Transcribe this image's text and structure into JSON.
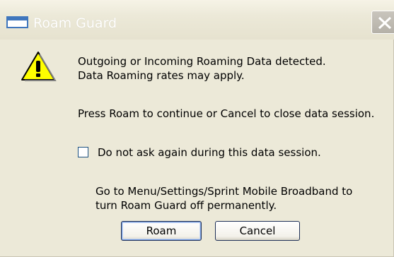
{
  "window": {
    "title": "Roam Guard"
  },
  "dialog": {
    "message_line1": "Outgoing or Incoming Roaming Data detected.",
    "message_line2": "Data Roaming rates may apply.",
    "instruction": "Press Roam to continue or Cancel to close data session.",
    "checkbox_label": "Do not ask again during this data session.",
    "checkbox_checked": false,
    "info_line1": "Go to Menu/Settings/Sprint Mobile Broadband to",
    "info_line2": "turn Roam Guard off permanently.",
    "roam_label": "Roam",
    "cancel_label": "Cancel"
  },
  "colors": {
    "dialog_background": "#ece9d8",
    "close_button": "#c2beb6",
    "warning_yellow": "#ffff00",
    "button_border": "#1e2f57"
  },
  "icons": {
    "app": "window-icon",
    "close": "close-icon",
    "warning": "warning-icon"
  }
}
